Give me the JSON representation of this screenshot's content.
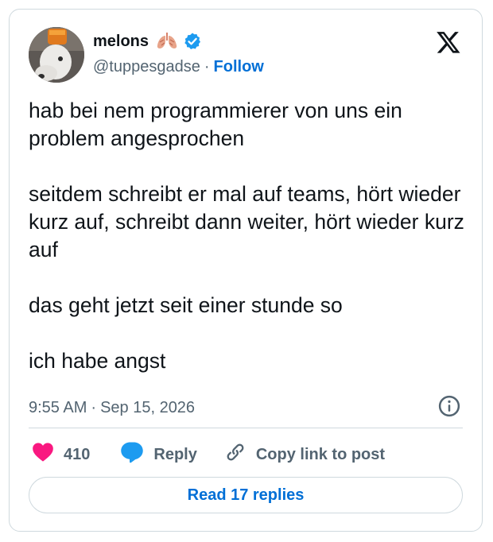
{
  "author": {
    "display_name": "melons",
    "handle": "@tuppesgadse",
    "separator": "·",
    "follow_label": "Follow",
    "verified_color": "#1d9bf0"
  },
  "tweet": {
    "paragraphs": [
      "hab bei nem programmierer von uns ein problem angesprochen",
      "seitdem schreibt er mal auf teams, hört wieder kurz auf, schreibt dann weiter, hört wieder kurz auf",
      "das geht jetzt seit einer stunde so",
      "ich habe angst"
    ],
    "time": "9:55 AM",
    "separator": "·",
    "date": "Sep 15, 2026"
  },
  "actions": {
    "like_count": "410",
    "reply_label": "Reply",
    "copy_link_label": "Copy link to post"
  },
  "read_replies_label": "Read 17 replies",
  "colors": {
    "like": "#f91880",
    "reply": "#1d9bf0",
    "link": "#006fd6",
    "border": "#cfd9de",
    "secondary_text": "#536471"
  },
  "icons": [
    "lungs-emoji",
    "verified-badge-icon",
    "x-logo-icon",
    "info-icon",
    "heart-icon",
    "reply-bubble-icon",
    "link-icon"
  ]
}
